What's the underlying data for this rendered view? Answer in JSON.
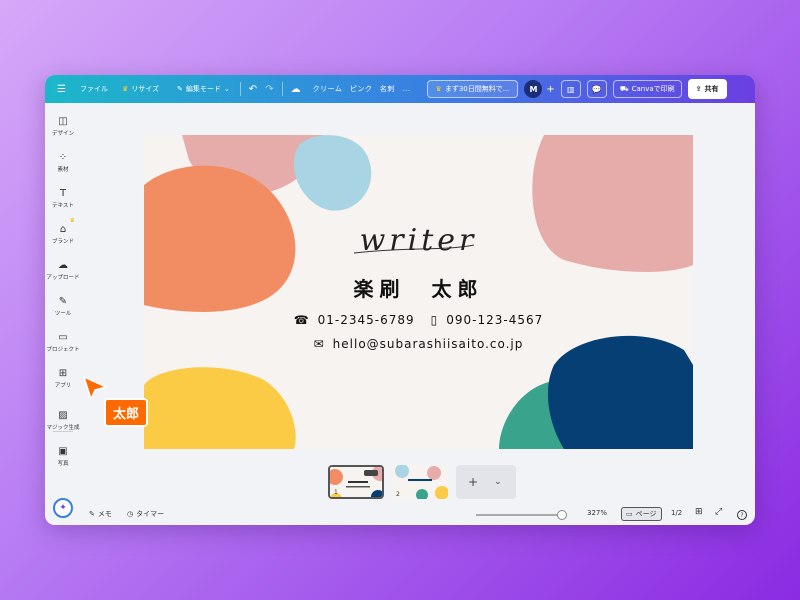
{
  "topbar": {
    "menu_file": "ファイル",
    "menu_resize": "リサイズ",
    "edit_mode": "編集モード",
    "doc_title": "クリーム　ピンク　名刺　...",
    "trial_label": "まず30日間無料で...",
    "avatar_initial": "M",
    "print_label": "Canvaで印刷",
    "share_label": "共有"
  },
  "sidebar": {
    "items": [
      {
        "label": "デザイン",
        "icon": "design-icon"
      },
      {
        "label": "素材",
        "icon": "elements-icon"
      },
      {
        "label": "テキスト",
        "icon": "text-icon"
      },
      {
        "label": "ブランド",
        "icon": "brand-icon"
      },
      {
        "label": "アップロード",
        "icon": "upload-icon"
      },
      {
        "label": "ツール",
        "icon": "tools-icon"
      },
      {
        "label": "プロジェクト",
        "icon": "folder-icon"
      },
      {
        "label": "アプリ",
        "icon": "apps-icon"
      },
      {
        "label": "マジック生成",
        "icon": "magic-media-icon"
      },
      {
        "label": "写真",
        "icon": "photo-icon"
      }
    ]
  },
  "card": {
    "title": "writer",
    "name": "楽刷　太郎",
    "phone1": "01-2345-6789",
    "phone2": "090-123-4567",
    "email": "hello@subarashiisaito.co.jp"
  },
  "colors": {
    "orange": "#f28d63",
    "pink": "#e5acaa",
    "blue_light": "#a9d4e3",
    "yellow": "#fbcb45",
    "navy": "#063f73",
    "green": "#3aa38b"
  },
  "pages": {
    "thumbs": [
      {
        "number": "1"
      },
      {
        "number": "2"
      }
    ]
  },
  "bottombar": {
    "notes": "メモ",
    "timer": "タイマー",
    "zoom": "327%",
    "page_view": "ページ",
    "page_count": "1/2",
    "help": "?"
  },
  "cursor": {
    "label": "太郎"
  }
}
